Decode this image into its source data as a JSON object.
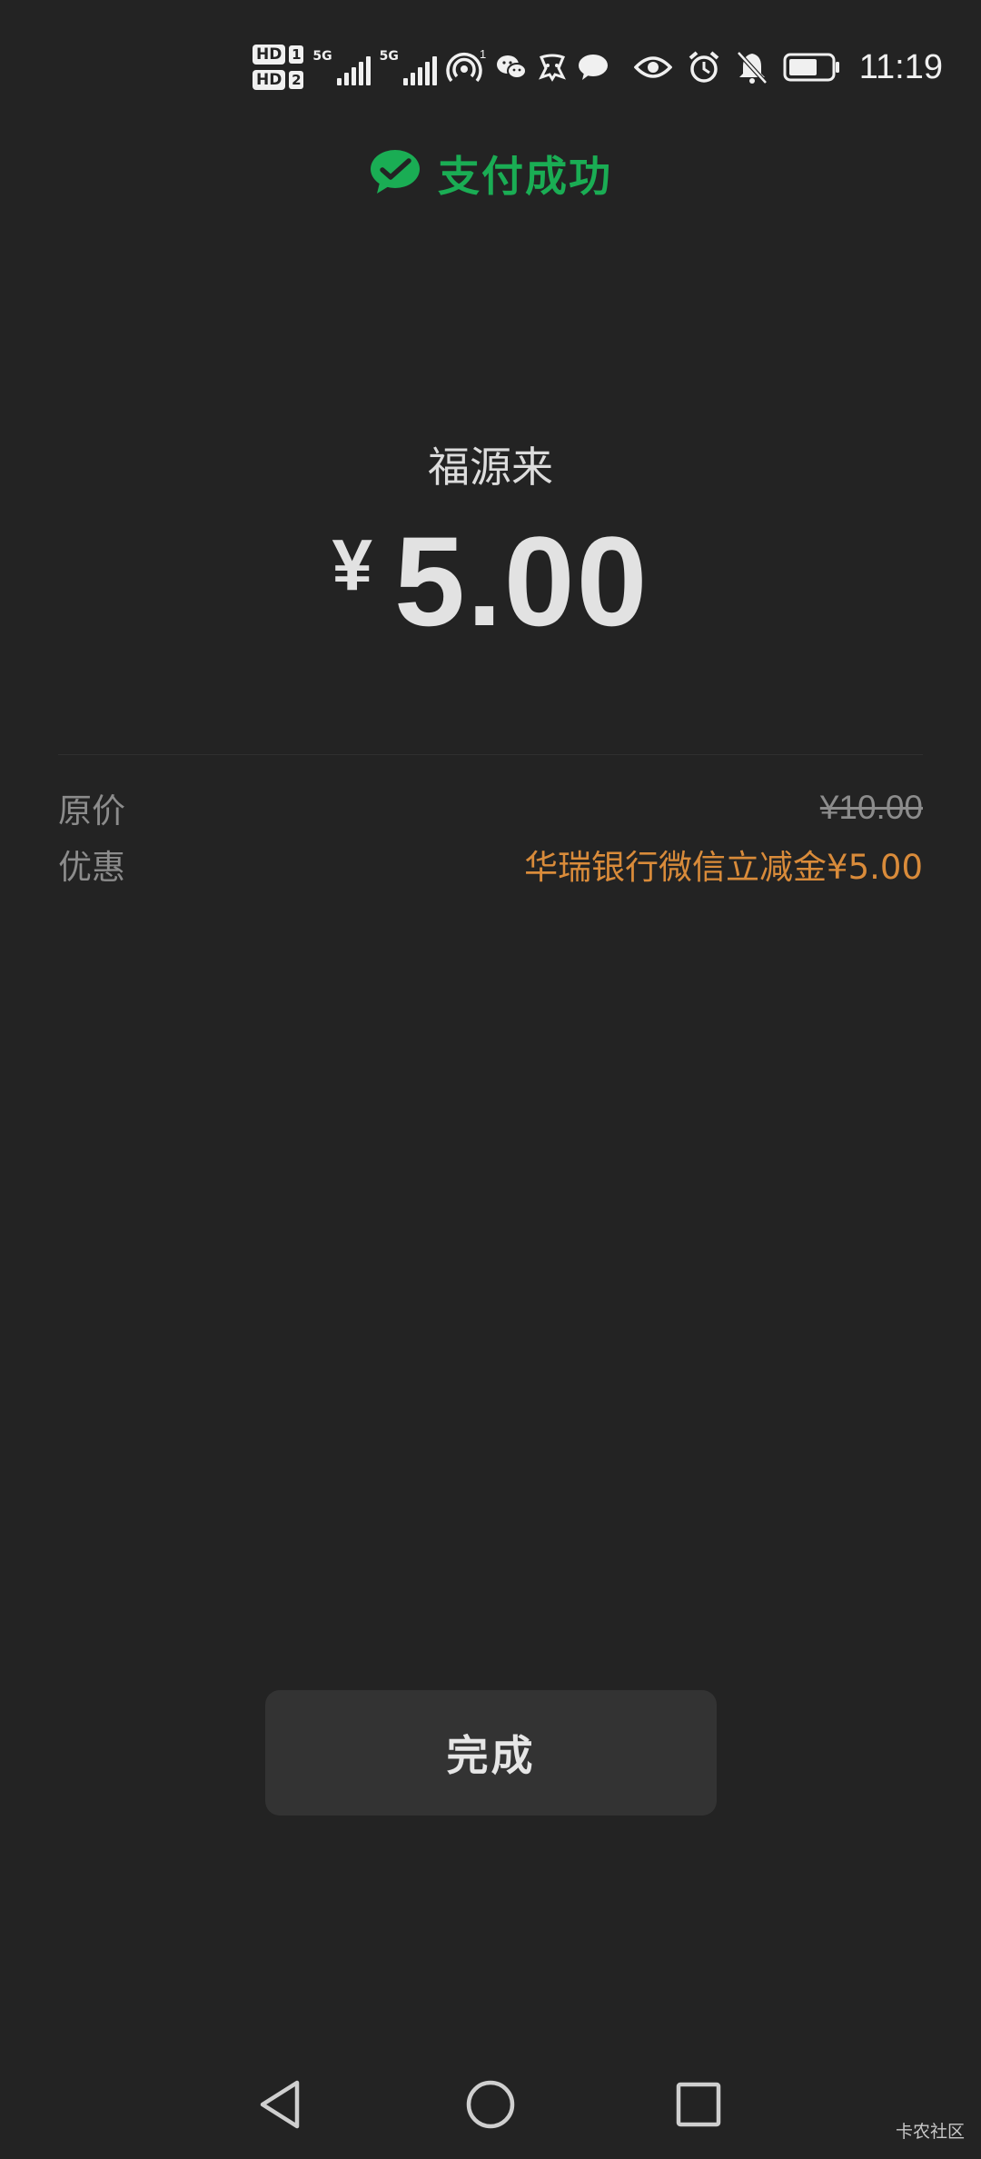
{
  "status_bar": {
    "sim1_badge": "HD",
    "sim1_num": "1",
    "sim2_badge": "HD",
    "sim2_num": "2",
    "net1": "5G",
    "net2": "5G",
    "hotspot_count": "1",
    "time": "11:19",
    "icons": [
      "wifi-hotspot-icon",
      "wechat-icon",
      "app-icon",
      "message-icon",
      "eye-icon",
      "alarm-icon",
      "bell-off-icon",
      "battery-icon"
    ]
  },
  "header": {
    "title": "支付成功",
    "icon": "wechat-pay-check-icon",
    "accent_color": "#1aad54"
  },
  "payment": {
    "merchant": "福源来",
    "currency_symbol": "¥",
    "amount": "5.00"
  },
  "details": {
    "original_price_label": "原价",
    "original_price_value": "¥10.00",
    "discount_label": "优惠",
    "discount_value": "华瑞银行微信立减金¥5.00",
    "discount_color": "#d98b3a"
  },
  "actions": {
    "done_label": "完成"
  },
  "nav": {
    "icons": [
      "back-icon",
      "home-icon",
      "recents-icon"
    ]
  },
  "watermark": {
    "text": "卡农社区"
  }
}
